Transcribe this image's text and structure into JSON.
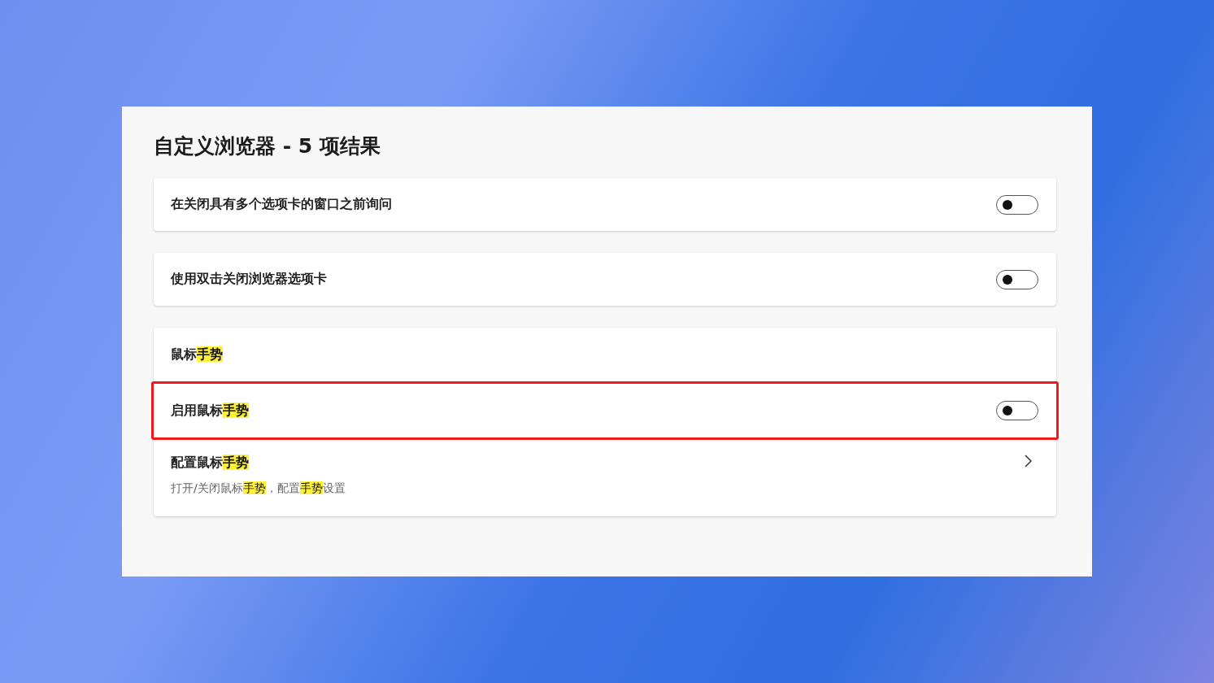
{
  "title": "自定义浏览器 - 5 项结果",
  "cards": [
    {
      "rows": [
        {
          "kind": "toggle",
          "label": [
            {
              "text": "在关闭具有多个选项卡的窗口之前询问",
              "highlighted": false
            }
          ],
          "on": false,
          "emphasized": false
        }
      ]
    },
    {
      "rows": [
        {
          "kind": "toggle",
          "label": [
            {
              "text": "使用双击关闭浏览器选项卡",
              "highlighted": false
            }
          ],
          "on": false,
          "emphasized": false
        }
      ]
    },
    {
      "rows": [
        {
          "kind": "header",
          "label": [
            {
              "text": "鼠标",
              "highlighted": false
            },
            {
              "text": "手势",
              "highlighted": true
            }
          ],
          "emphasized": false
        },
        {
          "kind": "toggle",
          "label": [
            {
              "text": "启用鼠标",
              "highlighted": false
            },
            {
              "text": "手势",
              "highlighted": true
            }
          ],
          "on": false,
          "emphasized": true
        },
        {
          "kind": "link",
          "label": [
            {
              "text": "配置鼠标",
              "highlighted": false
            },
            {
              "text": "手势",
              "highlighted": true
            }
          ],
          "description": [
            {
              "text": "打开/关闭鼠标",
              "highlighted": false
            },
            {
              "text": "手势",
              "highlighted": true
            },
            {
              "text": "，配置",
              "highlighted": false
            },
            {
              "text": "手势",
              "highlighted": true
            },
            {
              "text": "设置",
              "highlighted": false
            }
          ],
          "emphasized": false
        }
      ]
    }
  ]
}
